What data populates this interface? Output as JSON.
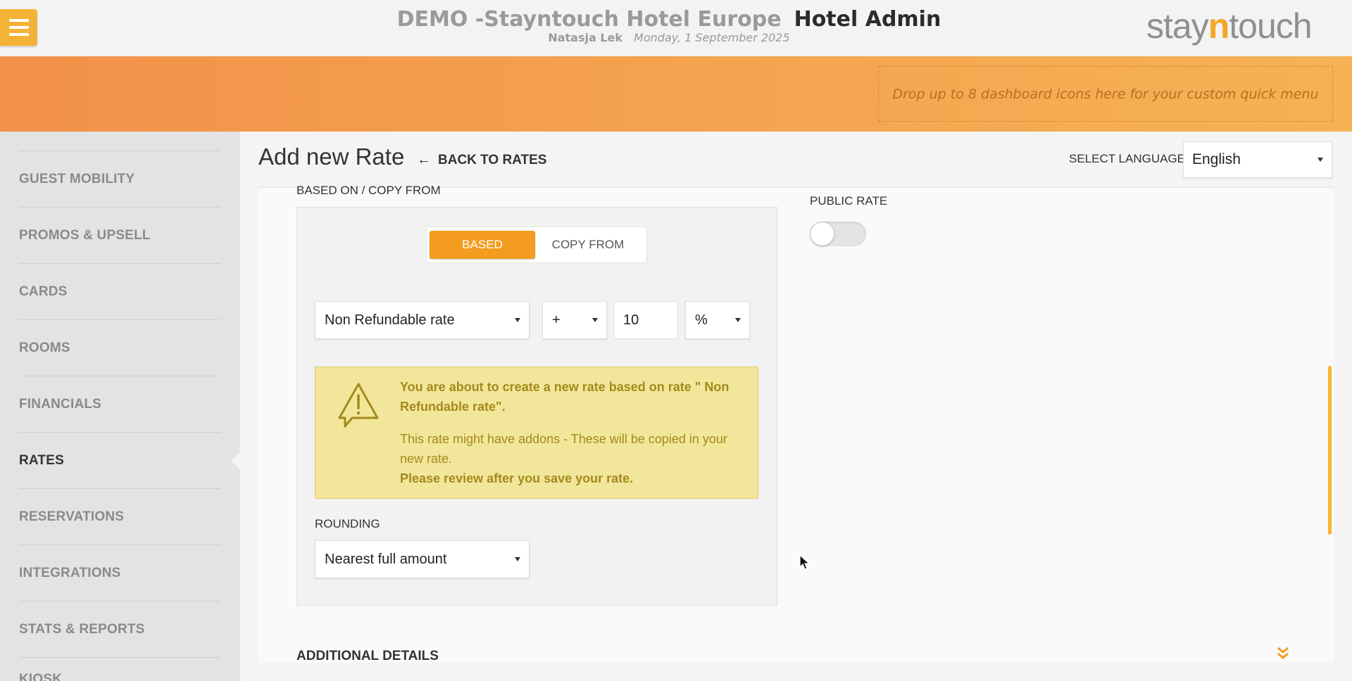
{
  "header": {
    "hotel_name": "DEMO -Stayntouch Hotel Europe",
    "app_name": "Hotel Admin",
    "user": "Natasja Lek",
    "date": "Monday, 1 September 2025",
    "logo_prefix": "stay",
    "logo_accent": "n",
    "logo_suffix": "touch"
  },
  "quick_menu": {
    "placeholder": "Drop up to 8 dashboard icons here for your custom quick menu"
  },
  "sidebar": {
    "items": [
      {
        "label": "GUEST MOBILITY"
      },
      {
        "label": "PROMOS & UPSELL"
      },
      {
        "label": "CARDS"
      },
      {
        "label": "ROOMS"
      },
      {
        "label": "FINANCIALS"
      },
      {
        "label": "RATES",
        "active": true
      },
      {
        "label": "RESERVATIONS"
      },
      {
        "label": "INTEGRATIONS"
      },
      {
        "label": "STATS & REPORTS"
      },
      {
        "label": "KIOSK"
      }
    ]
  },
  "page": {
    "title": "Add new Rate",
    "back_label": "BACK TO RATES",
    "language_label": "SELECT LANGUAGE",
    "language_value": "English"
  },
  "form": {
    "based_section_label": "BASED ON / COPY FROM",
    "seg_based": "BASED",
    "seg_copy": "COPY FROM",
    "based_rate": "Non Refundable rate",
    "operator": "+",
    "amount": "10",
    "unit": "%",
    "warning_title": "You are about to create a new rate based on rate \" Non Refundable rate\".",
    "warning_body": "This rate might have addons - These will be copied in your new rate.",
    "warning_review": "Please review after you save your rate.",
    "rounding_label": "ROUNDING",
    "rounding_value": "Nearest full amount",
    "public_rate_label": "PUBLIC RATE",
    "public_rate_on": false,
    "additional_details": "ADDITIONAL DETAILS"
  },
  "colors": {
    "accent": "#f39c1f",
    "band_start": "#f2914a",
    "band_end": "#f5b255",
    "warning_bg": "#f2e69a",
    "warning_text": "#a48a1c"
  },
  "icons": {
    "menu": "hamburger-icon",
    "back": "arrow-left-icon",
    "warning": "warning-triangle-icon",
    "expand": "double-chevron-down-icon"
  }
}
